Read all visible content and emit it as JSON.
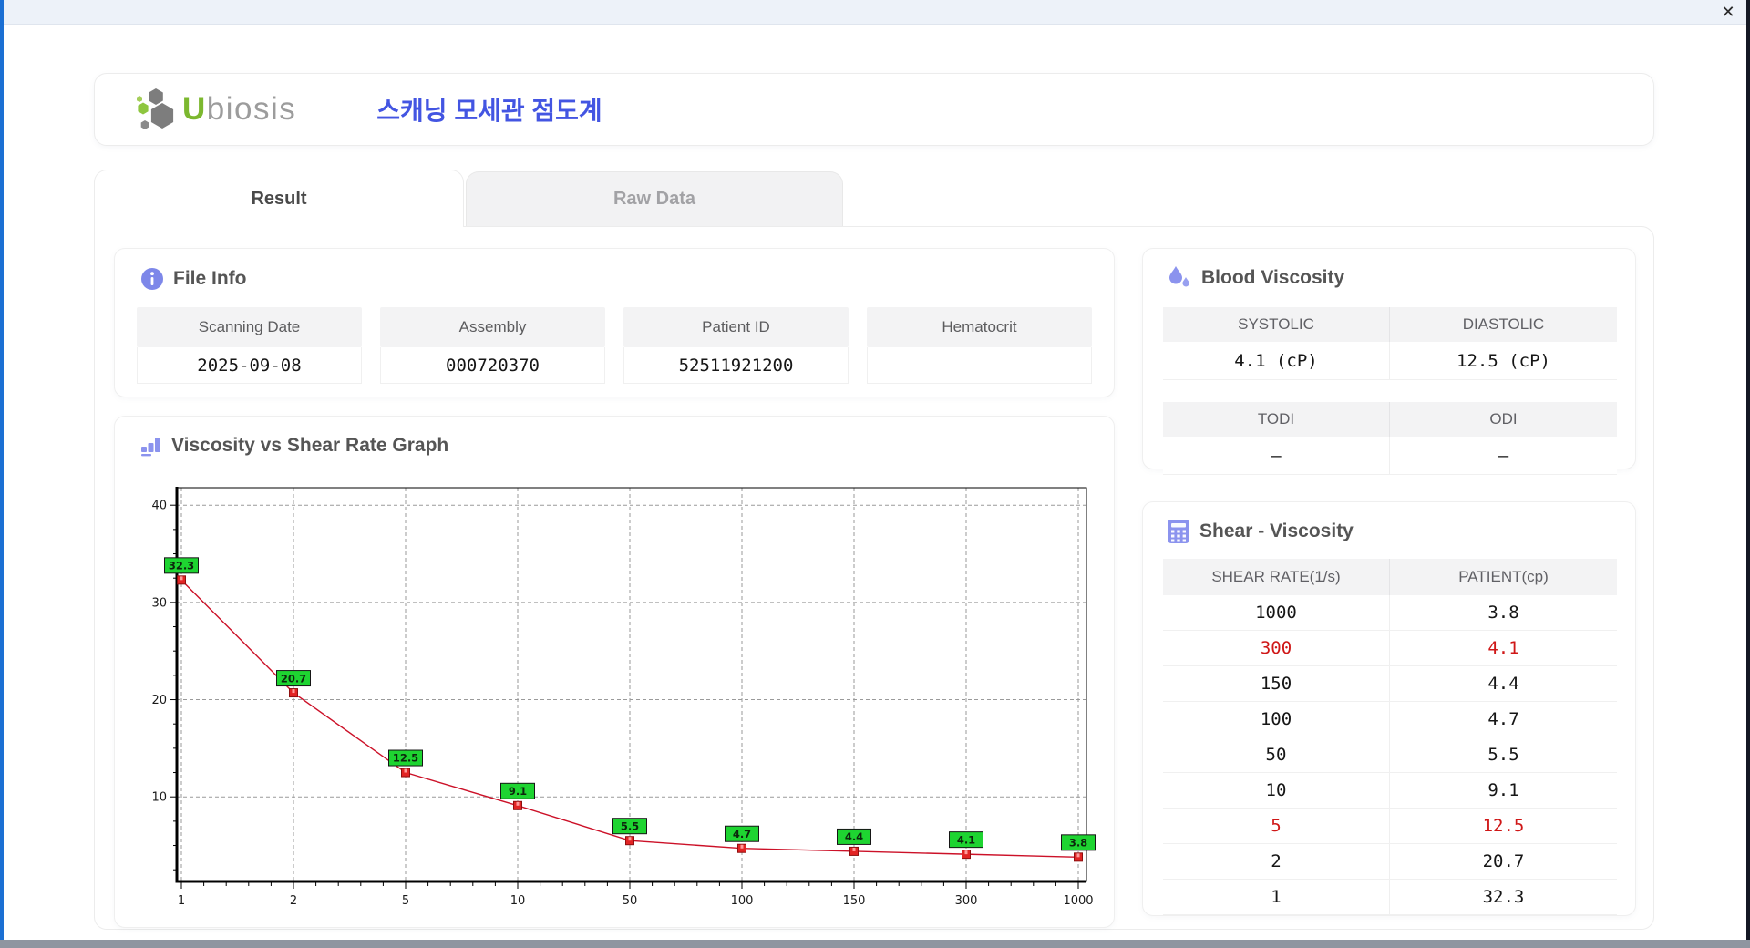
{
  "titlebar": {
    "close_label": "✕"
  },
  "header": {
    "logo": {
      "icon": "hexagon-cluster",
      "brand_accent": "U",
      "brand_rest": "biosis"
    },
    "app_title": "스캐닝 모세관 점도계"
  },
  "tabs": {
    "result_label": "Result",
    "raw_data_label": "Raw Data",
    "active_tab": "Result"
  },
  "file_info": {
    "title": "File Info",
    "icon": "info-icon",
    "fields": [
      {
        "label": "Scanning Date",
        "value": "2025-09-08"
      },
      {
        "label": "Assembly",
        "value": "000720370"
      },
      {
        "label": "Patient ID",
        "value": "52511921200"
      },
      {
        "label": "Hematocrit",
        "value": ""
      }
    ]
  },
  "blood_viscosity": {
    "title": "Blood Viscosity",
    "icon": "droplets-icon",
    "systolic_label": "SYSTOLIC",
    "systolic_value": "4.1 (cP)",
    "diastolic_label": "DIASTOLIC",
    "diastolic_value": "12.5 (cP)",
    "todi_label": "TODI",
    "todi_value": "–",
    "odi_label": "ODI",
    "odi_value": "–"
  },
  "shear_viscosity": {
    "title": "Shear - Viscosity",
    "icon": "calculator-icon",
    "columns": [
      "SHEAR RATE(1/s)",
      "PATIENT(cp)"
    ],
    "rows": [
      {
        "shear_rate": "1000",
        "patient": "3.8",
        "highlight": false
      },
      {
        "shear_rate": "300",
        "patient": "4.1",
        "highlight": true
      },
      {
        "shear_rate": "150",
        "patient": "4.4",
        "highlight": false
      },
      {
        "shear_rate": "100",
        "patient": "4.7",
        "highlight": false
      },
      {
        "shear_rate": "50",
        "patient": "5.5",
        "highlight": false
      },
      {
        "shear_rate": "10",
        "patient": "9.1",
        "highlight": false
      },
      {
        "shear_rate": "5",
        "patient": "12.5",
        "highlight": true
      },
      {
        "shear_rate": "2",
        "patient": "20.7",
        "highlight": false
      },
      {
        "shear_rate": "1",
        "patient": "32.3",
        "highlight": false
      }
    ]
  },
  "graph": {
    "title": "Viscosity vs Shear Rate Graph",
    "icon": "bar-chart-icon"
  },
  "chart_data": {
    "type": "line",
    "title": "Viscosity vs Shear Rate Graph",
    "xlabel": "",
    "ylabel": "",
    "x": [
      1,
      2,
      5,
      10,
      50,
      100,
      150,
      300,
      1000
    ],
    "x_tick_labels": [
      "1",
      "2",
      "5",
      "10",
      "50",
      "100",
      "150",
      "300",
      "1000"
    ],
    "x_axis_type": "categorical-evenly-spaced",
    "values": [
      32.3,
      20.7,
      12.5,
      9.1,
      5.5,
      4.7,
      4.4,
      4.1,
      3.8
    ],
    "point_labels": [
      "32.3",
      "20.7",
      "12.5",
      "9.1",
      "5.5",
      "4.7",
      "4.4",
      "4.1",
      "3.8"
    ],
    "y_ticks": [
      10,
      20,
      30,
      40
    ],
    "ylim": [
      1.3,
      41.8
    ],
    "grid": "dashed",
    "legend": "none",
    "line_color": "#cc1128",
    "marker_color": "#e22424",
    "marker_border": "#8f0f0f",
    "label_bg": "#1ed431",
    "label_border": "#161616",
    "label_text_color": "#0d260d"
  },
  "colors": {
    "accent_purple": "#8b93ee",
    "brand_green": "#7cb82f",
    "title_blue": "#4355e2",
    "highlight_red": "#cf1717",
    "frame_blue_edge": "#1b6fd3"
  }
}
